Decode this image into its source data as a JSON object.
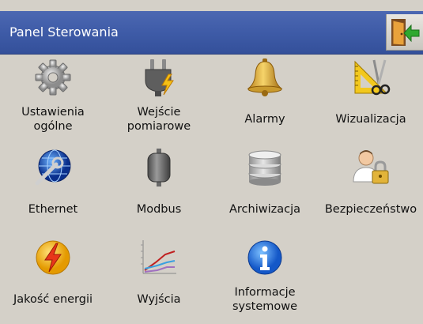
{
  "header": {
    "title": "Panel Sterowania",
    "exit_icon": "exit-door-icon"
  },
  "colors": {
    "header_bg": "#3d5aa6",
    "window_bg": "#d4d0c8",
    "text": "#111111"
  },
  "tiles": [
    {
      "label": "Ustawienia\nogólne",
      "icon": "gear-icon"
    },
    {
      "label": "Wejście\npomiarowe",
      "icon": "power-plug-icon"
    },
    {
      "label": "Alarmy",
      "icon": "bell-icon"
    },
    {
      "label": "Wizualizacja",
      "icon": "ruler-scissors-icon"
    },
    {
      "label": "Ethernet",
      "icon": "globe-wrench-icon"
    },
    {
      "label": "Modbus",
      "icon": "bus-device-icon"
    },
    {
      "label": "Archiwizacja",
      "icon": "database-icon"
    },
    {
      "label": "Bezpieczeństwo",
      "icon": "user-lock-icon"
    },
    {
      "label": "Jakość energii",
      "icon": "energy-bolt-icon"
    },
    {
      "label": "Wyjścia",
      "icon": "line-chart-icon"
    },
    {
      "label": "Informacje\nsystemowe",
      "icon": "info-icon"
    }
  ]
}
